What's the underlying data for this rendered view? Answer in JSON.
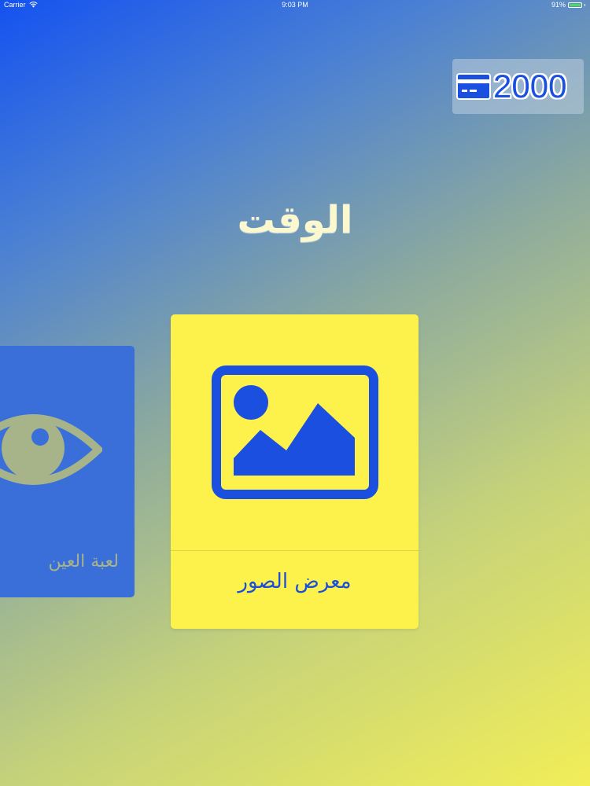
{
  "status_bar": {
    "carrier": "Carrier",
    "time": "9:03 PM",
    "battery": "91%",
    "wifi_icon": "wifi-icon",
    "battery_icon": "battery-icon"
  },
  "credits": {
    "icon": "credit-card-icon",
    "value": "2000"
  },
  "title": "الوقت",
  "cards": [
    {
      "label": "لعبة العين",
      "icon": "eye-icon",
      "color": "#3a6fd9"
    },
    {
      "label": "معرض الصور",
      "icon": "image-gallery-icon",
      "color": "#fdf14c"
    }
  ],
  "colors": {
    "accent_blue": "#1a4fe0",
    "card_yellow": "#fdf14c",
    "title_cream": "#fbf7cf"
  }
}
